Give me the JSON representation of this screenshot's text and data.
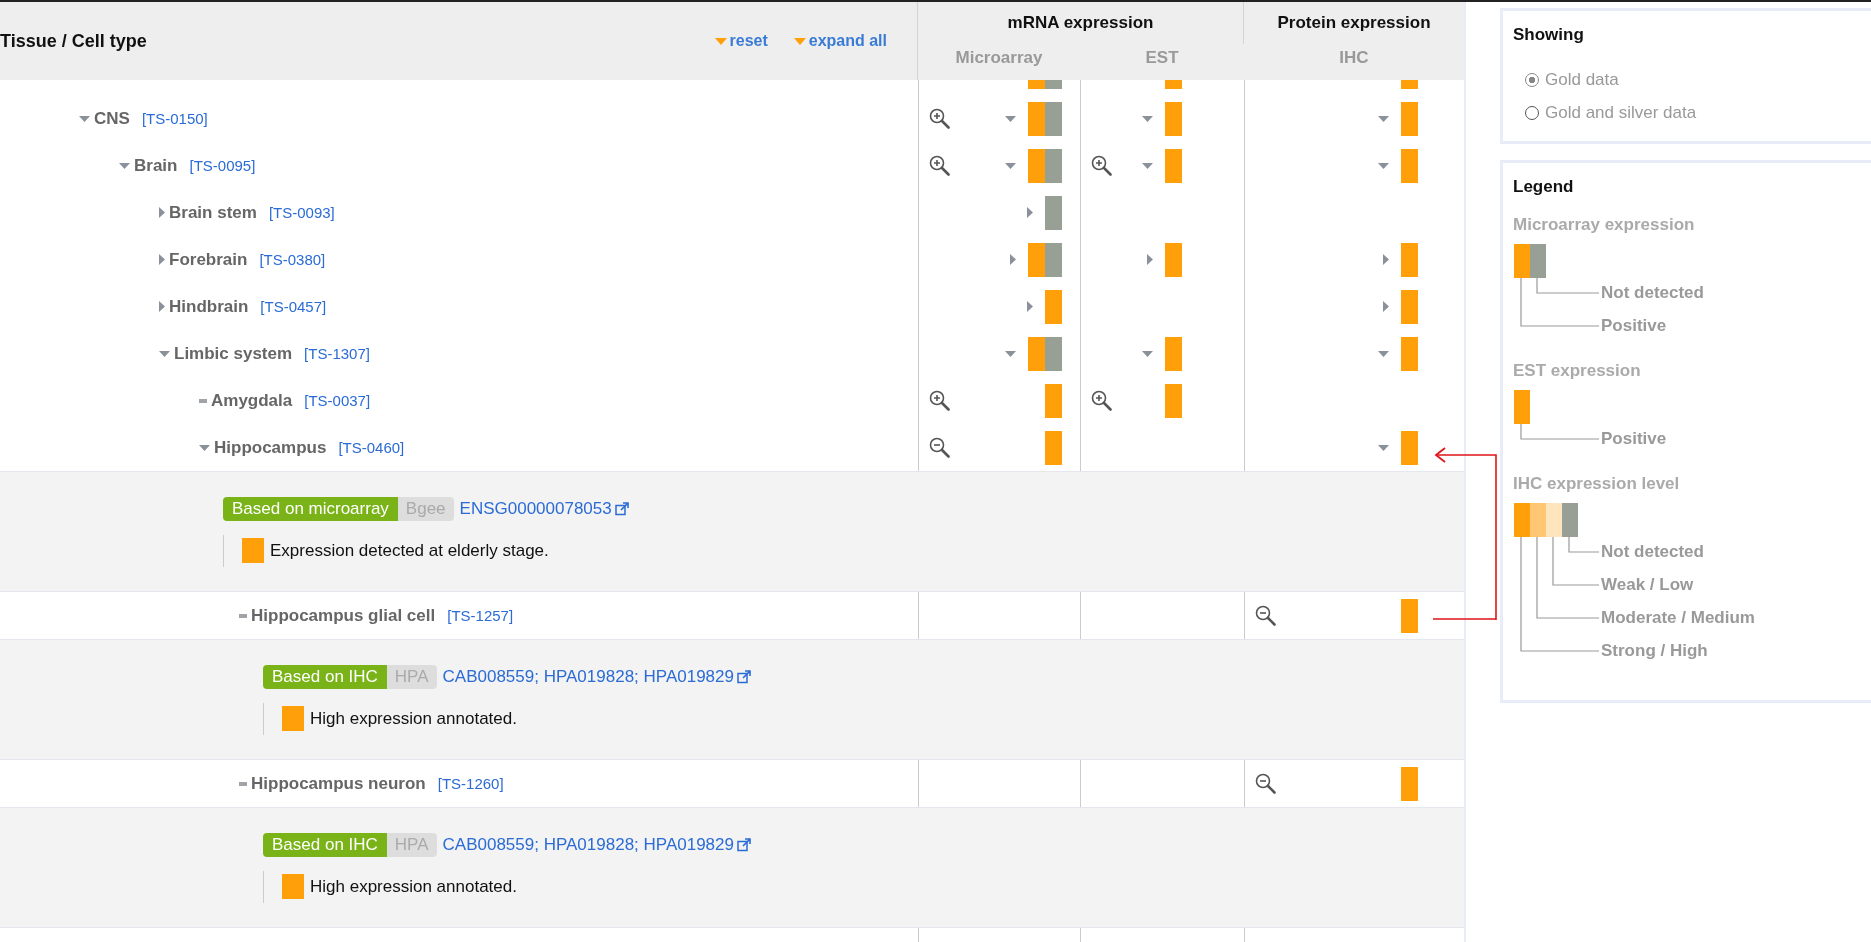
{
  "header": {
    "title": "Tissue / Cell type",
    "actions": [
      "reset",
      "expand all"
    ],
    "groups": [
      "mRNA expression",
      "Protein expression"
    ],
    "columns": [
      "Microarray",
      "EST",
      "IHC"
    ]
  },
  "clipped_row": {
    "cells": {
      "microarray": {
        "bars": [
          {
            "kind": "positive"
          },
          {
            "kind": "not_detected"
          }
        ]
      },
      "est": {
        "bars": [
          {
            "kind": "positive"
          }
        ]
      },
      "ihc": {
        "bars": [
          {
            "kind": "strong"
          }
        ]
      }
    }
  },
  "tree": [
    {
      "label": "CNS",
      "code": "[TS-0150]",
      "kind": "branch",
      "expanded": true,
      "cells": {
        "microarray": {
          "zoomed": false,
          "expanded": true,
          "bars": [
            {
              "kind": "positive"
            },
            {
              "kind": "not_detected"
            }
          ]
        },
        "est": {
          "expanded": true,
          "bars": [
            {
              "kind": "positive"
            }
          ]
        },
        "ihc": {
          "expanded": true,
          "bars": [
            {
              "kind": "strong"
            }
          ]
        }
      },
      "children": [
        {
          "label": "Brain",
          "code": "[TS-0095]",
          "kind": "branch",
          "expanded": true,
          "cells": {
            "microarray": {
              "zoomed": false,
              "expanded": true,
              "bars": [
                {
                  "kind": "positive"
                },
                {
                  "kind": "not_detected"
                }
              ]
            },
            "est": {
              "zoomed": false,
              "expanded": true,
              "bars": [
                {
                  "kind": "positive"
                }
              ]
            },
            "ihc": {
              "expanded": true,
              "bars": [
                {
                  "kind": "strong"
                }
              ]
            }
          },
          "children": [
            {
              "label": "Brain stem",
              "code": "[TS-0093]",
              "kind": "branch",
              "expanded": false,
              "cells": {
                "microarray": {
                  "expanded": false,
                  "bars": [
                    {
                      "kind": "not_detected"
                    }
                  ]
                }
              }
            },
            {
              "label": "Forebrain",
              "code": "[TS-0380]",
              "kind": "branch",
              "expanded": false,
              "cells": {
                "microarray": {
                  "expanded": false,
                  "bars": [
                    {
                      "kind": "positive"
                    },
                    {
                      "kind": "not_detected"
                    }
                  ]
                },
                "est": {
                  "expanded": false,
                  "bars": [
                    {
                      "kind": "positive"
                    }
                  ]
                },
                "ihc": {
                  "expanded": false,
                  "bars": [
                    {
                      "kind": "strong"
                    }
                  ]
                }
              }
            },
            {
              "label": "Hindbrain",
              "code": "[TS-0457]",
              "kind": "branch",
              "expanded": false,
              "cells": {
                "microarray": {
                  "expanded": false,
                  "bars": [
                    {
                      "kind": "positive"
                    }
                  ]
                },
                "ihc": {
                  "expanded": false,
                  "bars": [
                    {
                      "kind": "strong"
                    }
                  ]
                }
              }
            },
            {
              "label": "Limbic system",
              "code": "[TS-1307]",
              "kind": "branch",
              "expanded": true,
              "cells": {
                "microarray": {
                  "expanded": true,
                  "bars": [
                    {
                      "kind": "positive"
                    },
                    {
                      "kind": "not_detected"
                    }
                  ]
                },
                "est": {
                  "expanded": true,
                  "bars": [
                    {
                      "kind": "positive"
                    }
                  ]
                },
                "ihc": {
                  "expanded": true,
                  "bars": [
                    {
                      "kind": "strong"
                    }
                  ]
                }
              },
              "children": [
                {
                  "label": "Amygdala",
                  "code": "[TS-0037]",
                  "kind": "leaf",
                  "cells": {
                    "microarray": {
                      "zoomed": false,
                      "bars": [
                        {
                          "kind": "positive"
                        }
                      ]
                    },
                    "est": {
                      "zoomed": false,
                      "bars": [
                        {
                          "kind": "positive"
                        }
                      ]
                    }
                  }
                },
                {
                  "label": "Hippocampus",
                  "code": "[TS-0460]",
                  "kind": "branch",
                  "expanded": true,
                  "cells": {
                    "microarray": {
                      "zoomed": true,
                      "bars": [
                        {
                          "kind": "positive"
                        }
                      ]
                    },
                    "ihc": {
                      "expanded": true,
                      "bars": [
                        {
                          "kind": "strong"
                        }
                      ]
                    }
                  },
                  "evidence": {
                    "method": "Based on microarray",
                    "source": "Bgee",
                    "link": "ENSG00000078053",
                    "kind": "positive",
                    "note": "Expression detected at elderly stage."
                  },
                  "children": [
                    {
                      "label": "Hippocampus glial cell",
                      "code": "[TS-1257]",
                      "kind": "leaf",
                      "cells": {
                        "ihc": {
                          "zoomed": true,
                          "bars": [
                            {
                              "kind": "strong"
                            }
                          ]
                        }
                      },
                      "evidence": {
                        "method": "Based on IHC",
                        "source": "HPA",
                        "link": "CAB008559; HPA019828; HPA019829",
                        "kind": "strong",
                        "note": "High expression annotated."
                      }
                    },
                    {
                      "label": "Hippocampus neuron",
                      "code": "[TS-1260]",
                      "kind": "leaf",
                      "cells": {
                        "ihc": {
                          "zoomed": true,
                          "bars": [
                            {
                              "kind": "strong"
                            }
                          ]
                        }
                      },
                      "evidence": {
                        "method": "Based on IHC",
                        "source": "HPA",
                        "link": "CAB008559; HPA019828; HPA019829",
                        "kind": "strong",
                        "note": "High expression annotated."
                      }
                    }
                  ]
                }
              ]
            }
          ]
        }
      ]
    }
  ],
  "showing": {
    "title": "Showing",
    "options": [
      {
        "label": "Gold data",
        "selected": true
      },
      {
        "label": "Gold and silver data",
        "selected": false
      }
    ]
  },
  "legend": {
    "title": "Legend",
    "sections": [
      {
        "title": "Microarray expression",
        "items": [
          {
            "label": "Not detected",
            "color": "#98a096"
          },
          {
            "label": "Positive",
            "color": "#ffa00a"
          }
        ]
      },
      {
        "title": "EST expression",
        "items": [
          {
            "label": "Positive",
            "color": "#ffa00a"
          }
        ]
      },
      {
        "title": "IHC expression level",
        "items": [
          {
            "label": "Not detected",
            "color": "#98a096"
          },
          {
            "label": "Weak / Low",
            "color": "#ffe5bd"
          },
          {
            "label": "Moderate / Medium",
            "color": "#ffc673"
          },
          {
            "label": "Strong / High",
            "color": "#ffa00a"
          }
        ]
      }
    ]
  }
}
